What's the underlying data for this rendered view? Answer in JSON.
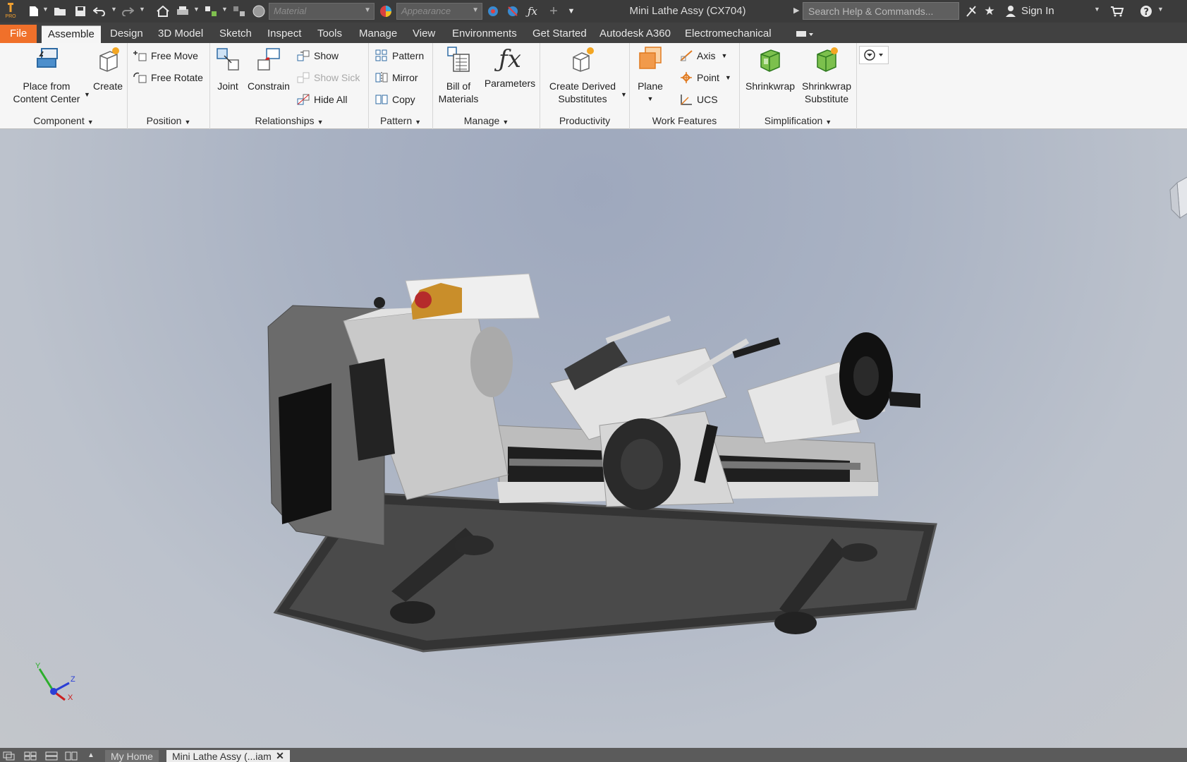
{
  "titlebar": {
    "app_title": "Mini Lathe Assy (CX704)",
    "material_placeholder": "Material",
    "appearance_placeholder": "Appearance",
    "search_placeholder": "Search Help & Commands...",
    "sign_in": "Sign In",
    "logo_text": "PRO"
  },
  "tabs": [
    {
      "label": "File"
    },
    {
      "label": "Assemble"
    },
    {
      "label": "Design"
    },
    {
      "label": "3D Model"
    },
    {
      "label": "Sketch"
    },
    {
      "label": "Inspect"
    },
    {
      "label": "Tools"
    },
    {
      "label": "Manage"
    },
    {
      "label": "View"
    },
    {
      "label": "Environments"
    },
    {
      "label": "Get Started"
    },
    {
      "label": "Autodesk A360"
    },
    {
      "label": "Electromechanical"
    }
  ],
  "ribbon": {
    "component": {
      "label": "Component",
      "place_line1": "Place from",
      "place_line2": "Content Center",
      "create": "Create"
    },
    "position": {
      "label": "Position",
      "free_move": "Free Move",
      "free_rotate": "Free Rotate"
    },
    "relationships": {
      "label": "Relationships",
      "joint": "Joint",
      "constrain": "Constrain",
      "show": "Show",
      "show_sick": "Show Sick",
      "hide_all": "Hide All"
    },
    "pattern": {
      "label": "Pattern",
      "pattern": "Pattern",
      "mirror": "Mirror",
      "copy": "Copy"
    },
    "manage": {
      "label": "Manage",
      "bom_line1": "Bill of",
      "bom_line2": "Materials",
      "parameters": "Parameters"
    },
    "productivity": {
      "label": "Productivity",
      "derived_line1": "Create Derived",
      "derived_line2": "Substitutes"
    },
    "work_features": {
      "label": "Work Features",
      "plane": "Plane",
      "axis": "Axis",
      "point": "Point",
      "ucs": "UCS"
    },
    "simplification": {
      "label": "Simplification",
      "shrinkwrap": "Shrinkwrap",
      "shrinkwrap_sub_line1": "Shrinkwrap",
      "shrinkwrap_sub_line2": "Substitute"
    }
  },
  "viewport": {
    "triad_x": "X",
    "triad_y": "Y",
    "triad_z": "Z"
  },
  "bottom_tabs": [
    {
      "label": "My Home"
    },
    {
      "label": "Mini Lathe Assy (...iam"
    }
  ],
  "colors": {
    "accent": "#f0702a",
    "titlebar_bg": "#3b3b3b",
    "ribbon_bg": "#f6f6f6",
    "viewport_top": "#9ea8bd",
    "viewport_bottom": "#c3c6cb"
  }
}
